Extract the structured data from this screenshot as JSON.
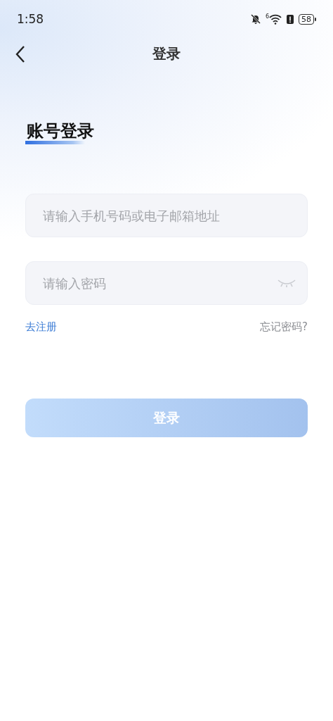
{
  "status_bar": {
    "time": "1:58",
    "wifi_generation": "6",
    "battery": "58"
  },
  "nav": {
    "title": "登录"
  },
  "heading": "账号登录",
  "fields": [
    {
      "kind": "text",
      "placeholder": "请输入手机号码或电子邮箱地址"
    },
    {
      "kind": "password",
      "placeholder": "请输入密码"
    }
  ],
  "links": {
    "register": "去注册",
    "forgot": "忘记密码?"
  },
  "login_button": {
    "label": "登录",
    "disabled": true
  }
}
